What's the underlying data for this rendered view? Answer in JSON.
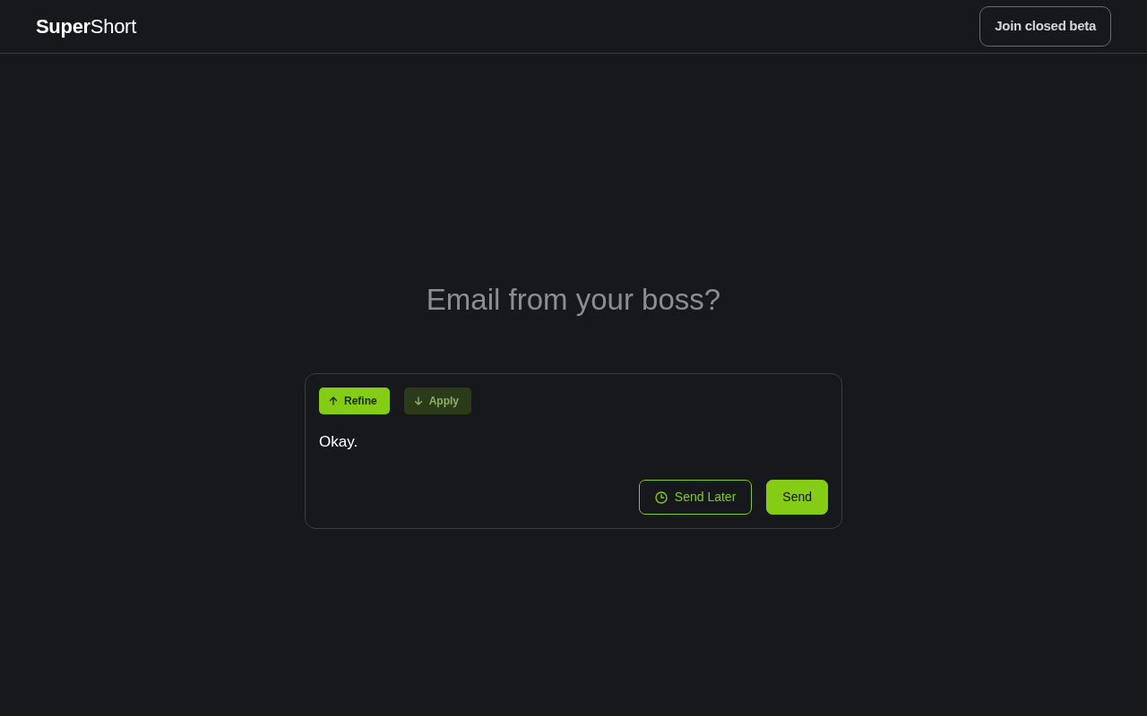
{
  "header": {
    "logo": "**Super**Short",
    "cta": "Join closed beta"
  },
  "heading": "Email from your boss?",
  "composer": {
    "tools": [
      {
        "label": "Refine",
        "kind": "up",
        "disabled": false
      },
      {
        "label": "Apply",
        "kind": "down",
        "disabled": true
      }
    ],
    "message": "Okay.",
    "actions": [
      {
        "label": "Send Later",
        "kind": "outline"
      },
      {
        "label": "Send",
        "kind": "solid"
      }
    ]
  }
}
